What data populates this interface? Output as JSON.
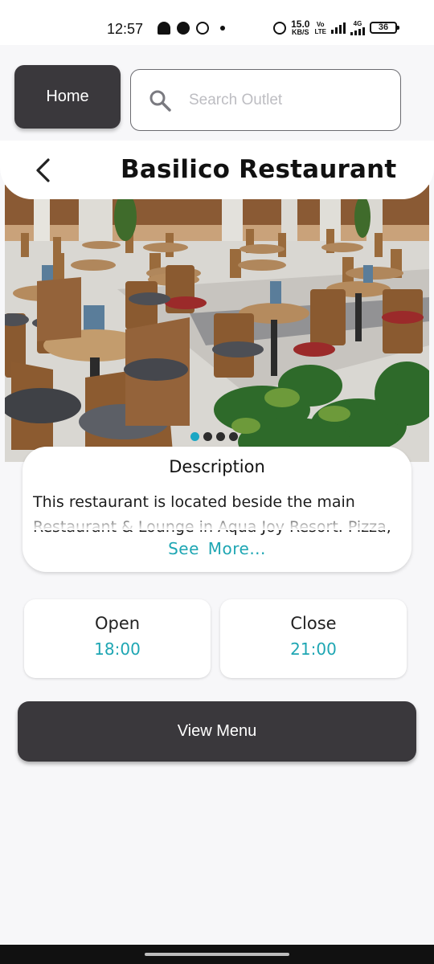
{
  "status_bar": {
    "time": "12:57",
    "net_speed_value": "15.0",
    "net_speed_unit": "KB/S",
    "volte_line1": "Vo",
    "volte_line2": "LTE",
    "network_type": "4G",
    "battery": "36"
  },
  "header": {
    "home_label": "Home",
    "search_placeholder": "Search Outlet"
  },
  "page": {
    "title": "Basilico Restaurant"
  },
  "carousel": {
    "dots": 4,
    "active_index": 0,
    "accent": "#1aa7c4"
  },
  "description": {
    "heading": "Description",
    "line1": "This restaurant is located beside the main",
    "line2": "Restaurant & Lounge in Aqua Joy Resort. Pizza,",
    "see_more": "See More..."
  },
  "hours": {
    "open_label": "Open",
    "open_time": "18:00",
    "close_label": "Close",
    "close_time": "21:00"
  },
  "actions": {
    "view_menu": "View Menu"
  },
  "colors": {
    "dark_button": "#3a383c",
    "accent_teal": "#1ea6b3",
    "background": "#f7f7f9"
  }
}
